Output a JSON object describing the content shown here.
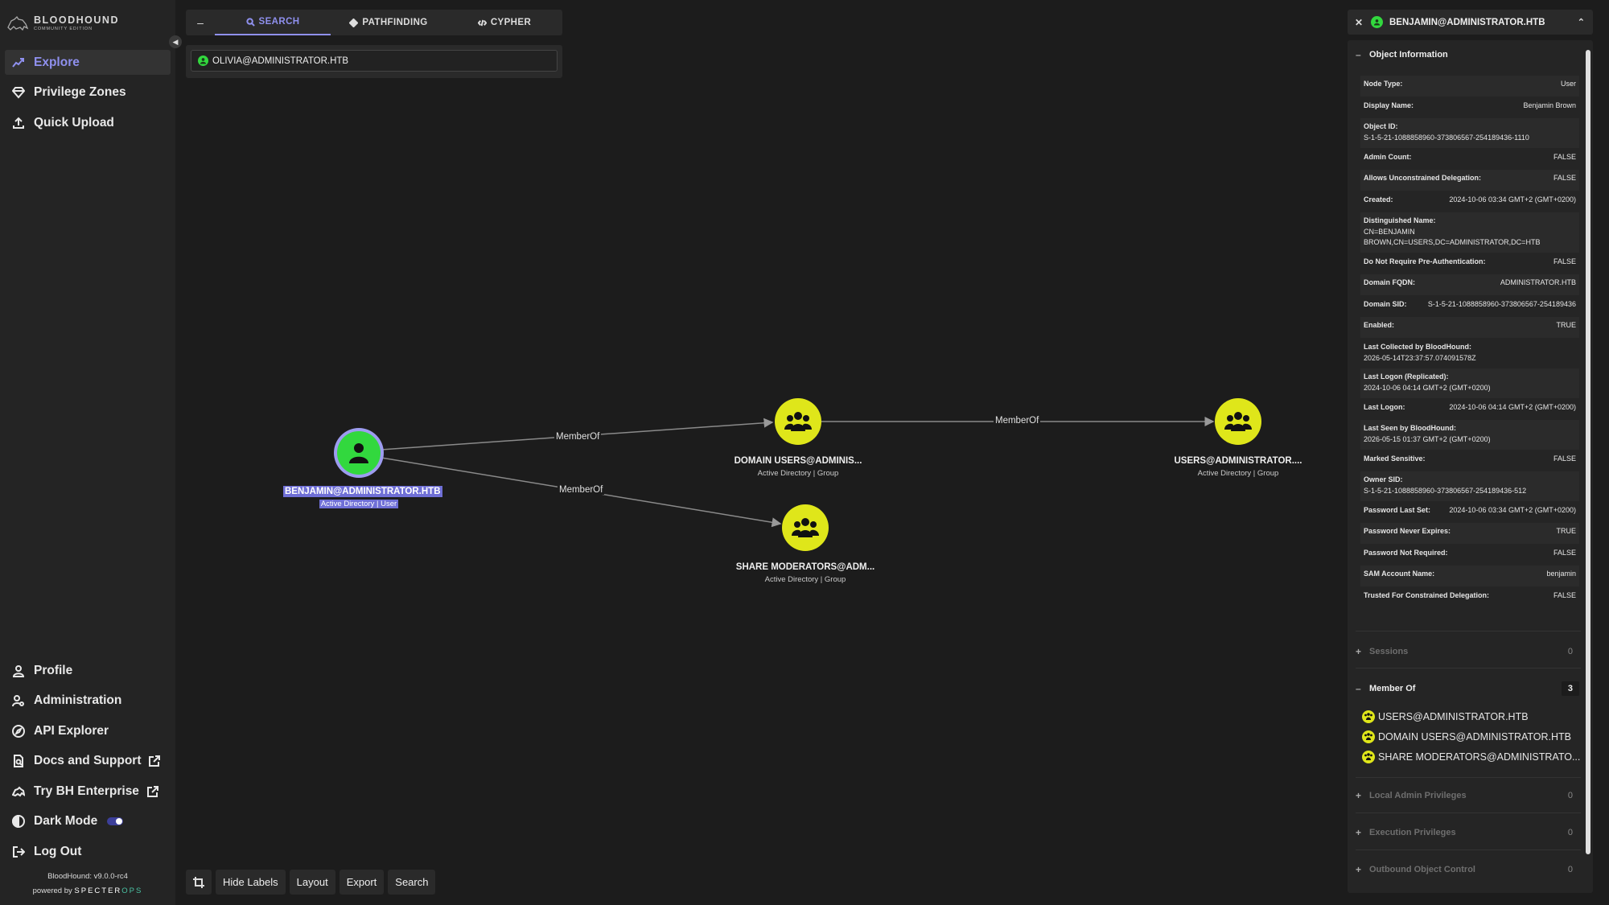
{
  "app": {
    "logo_line1": "BLOODHOUND",
    "logo_line2": "COMMUNITY EDITION",
    "version": "BloodHound: v9.0.0-rc4",
    "powered_by": "powered by",
    "brand_a": "SPECTER",
    "brand_b": "OPS"
  },
  "sidebar": {
    "top": [
      {
        "label": "Explore",
        "icon": "explore-icon",
        "active": true
      },
      {
        "label": "Privilege Zones",
        "icon": "diamond-icon"
      },
      {
        "label": "Quick Upload",
        "icon": "upload-icon"
      }
    ],
    "bottom": [
      {
        "label": "Profile",
        "icon": "profile-icon"
      },
      {
        "label": "Administration",
        "icon": "admin-icon"
      },
      {
        "label": "API Explorer",
        "icon": "compass-icon"
      },
      {
        "label": "Docs and Support",
        "icon": "docs-icon"
      },
      {
        "label": "Try BH Enterprise",
        "icon": "enterprise-icon"
      },
      {
        "label": "Dark Mode",
        "icon": "contrast-icon"
      },
      {
        "label": "Log Out",
        "icon": "logout-icon"
      }
    ]
  },
  "search": {
    "tabs": [
      {
        "label": "SEARCH"
      },
      {
        "label": "PATHFINDING"
      },
      {
        "label": "CYPHER"
      }
    ],
    "value": "OLIVIA@ADMINISTRATOR.HTB"
  },
  "graph": {
    "edges": [
      {
        "label": "MemberOf"
      },
      {
        "label": "MemberOf"
      },
      {
        "label": "MemberOf"
      }
    ],
    "nodes": [
      {
        "title": "BENJAMIN@ADMINISTRATOR.HTB",
        "sub": "Active Directory | User"
      },
      {
        "title": "DOMAIN USERS@ADMINIS...",
        "sub": "Active Directory | Group"
      },
      {
        "title": "USERS@ADMINISTRATOR....",
        "sub": "Active Directory | Group"
      },
      {
        "title": "SHARE MODERATORS@ADM...",
        "sub": "Active Directory | Group"
      }
    ]
  },
  "tools": {
    "hide_labels": "Hide Labels",
    "layout": "Layout",
    "export": "Export",
    "search": "Search"
  },
  "panel": {
    "title": "BENJAMIN@ADMINISTRATOR.HTB",
    "object_info": "Object Information",
    "props": [
      {
        "k": "Node Type:",
        "v": "User"
      },
      {
        "k": "Display Name:",
        "v": "Benjamin Brown"
      },
      {
        "k": "Object ID:",
        "v": "S-1-5-21-1088858960-373806567-254189436-1110",
        "multi": true
      },
      {
        "k": "Admin Count:",
        "v": "FALSE"
      },
      {
        "k": "Allows Unconstrained Delegation:",
        "v": "FALSE"
      },
      {
        "k": "Created:",
        "v": "2024-10-06 03:34 GMT+2 (GMT+0200)"
      },
      {
        "k": "Distinguished Name:",
        "v": "CN=BENJAMIN BROWN,CN=USERS,DC=ADMINISTRATOR,DC=HTB",
        "multi": true
      },
      {
        "k": "Do Not Require Pre-Authentication:",
        "v": "FALSE"
      },
      {
        "k": "Domain FQDN:",
        "v": "ADMINISTRATOR.HTB"
      },
      {
        "k": "Domain SID:",
        "v": "S-1-5-21-1088858960-373806567-254189436"
      },
      {
        "k": "Enabled:",
        "v": "TRUE"
      },
      {
        "k": "Last Collected by BloodHound:",
        "v": "2026-05-14T23:37:57.074091578Z",
        "multi": true
      },
      {
        "k": "Last Logon (Replicated):",
        "v": "2024-10-06 04:14 GMT+2 (GMT+0200)",
        "multi": true
      },
      {
        "k": "Last Logon:",
        "v": "2024-10-06 04:14 GMT+2 (GMT+0200)"
      },
      {
        "k": "Last Seen by BloodHound:",
        "v": "2026-05-15 01:37 GMT+2 (GMT+0200)",
        "multi": true
      },
      {
        "k": "Marked Sensitive:",
        "v": "FALSE"
      },
      {
        "k": "Owner SID:",
        "v": "S-1-5-21-1088858960-373806567-254189436-512",
        "multi": true
      },
      {
        "k": "Password Last Set:",
        "v": "2024-10-06 03:34 GMT+2 (GMT+0200)"
      },
      {
        "k": "Password Never Expires:",
        "v": "TRUE"
      },
      {
        "k": "Password Not Required:",
        "v": "FALSE"
      },
      {
        "k": "SAM Account Name:",
        "v": "benjamin"
      },
      {
        "k": "Trusted For Constrained Delegation:",
        "v": "FALSE"
      }
    ],
    "sessions": {
      "label": "Sessions",
      "count": "0"
    },
    "member_of": {
      "label": "Member Of",
      "count": "3",
      "items": [
        "USERS@ADMINISTRATOR.HTB",
        "DOMAIN USERS@ADMINISTRATOR.HTB",
        "SHARE MODERATORS@ADMINISTRATO..."
      ]
    },
    "local_admin": {
      "label": "Local Admin Privileges",
      "count": "0"
    },
    "execution": {
      "label": "Execution Privileges",
      "count": "0"
    },
    "outbound": {
      "label": "Outbound Object Control",
      "count": "0"
    }
  },
  "colors": {
    "accent": "#8f90ee",
    "user_node": "#32d83e",
    "group_node": "#dfe61a",
    "selection": "#6f6fd6"
  }
}
